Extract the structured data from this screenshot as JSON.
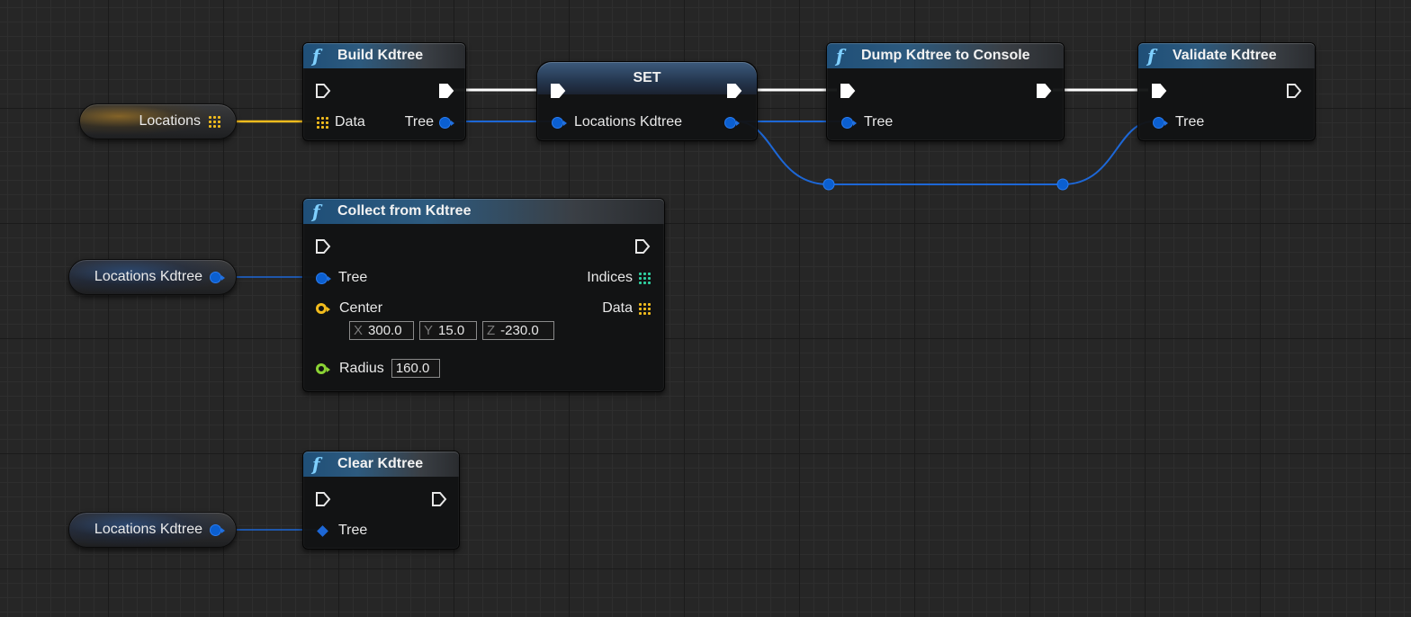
{
  "graph": {
    "nodes": {
      "build_kdtree": {
        "title": "Build Kdtree",
        "icon": "function-icon",
        "inputs": {
          "data": "Data"
        },
        "outputs": {
          "tree": "Tree"
        }
      },
      "set_node": {
        "title": "SET",
        "inputs": {
          "locations_kdtree": "Locations Kdtree"
        }
      },
      "dump_kdtree": {
        "title": "Dump Kdtree to Console",
        "icon": "function-icon",
        "inputs": {
          "tree": "Tree"
        }
      },
      "validate_kdtree": {
        "title": "Validate Kdtree",
        "icon": "function-icon",
        "inputs": {
          "tree": "Tree"
        }
      },
      "collect_from_kdtree": {
        "title": "Collect from Kdtree",
        "icon": "function-icon",
        "inputs": {
          "tree": "Tree",
          "center": "Center",
          "center_x": "300.0",
          "center_y": "15.0",
          "center_z": "-230.0",
          "radius": "Radius",
          "radius_value": "160.0",
          "axis_x": "X",
          "axis_y": "Y",
          "axis_z": "Z"
        },
        "outputs": {
          "indices": "Indices",
          "data": "Data"
        }
      },
      "clear_kdtree": {
        "title": "Clear Kdtree",
        "icon": "function-icon",
        "inputs": {
          "tree": "Tree"
        }
      }
    },
    "variables": {
      "locations": "Locations",
      "locations_kdtree_1": "Locations Kdtree",
      "locations_kdtree_2": "Locations Kdtree"
    }
  },
  "colors": {
    "object_pin": "#0b5fd0",
    "vector_pin": "#f2bc1d",
    "float_pin": "#8bd334",
    "exec_wire": "#ffffff",
    "array_wire": "#f2bc1d",
    "object_wire": "#1d67d6"
  }
}
